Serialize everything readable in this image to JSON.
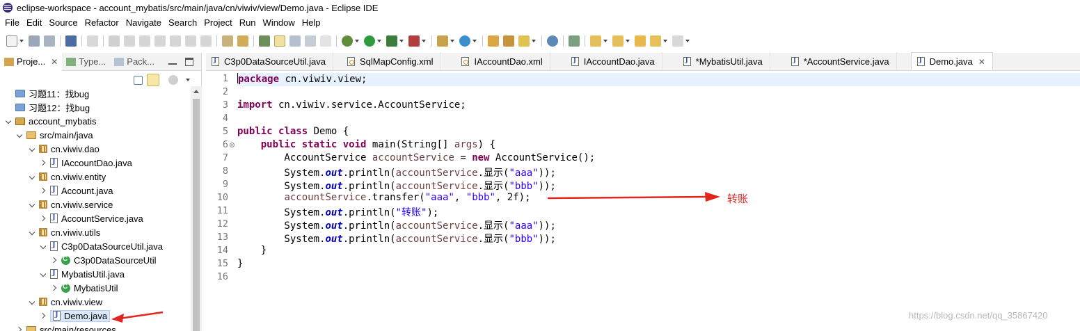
{
  "window": {
    "title": "eclipse-workspace - account_mybatis/src/main/java/cn/viwiv/view/Demo.java - Eclipse IDE"
  },
  "menu": [
    "File",
    "Edit",
    "Source",
    "Refactor",
    "Navigate",
    "Search",
    "Project",
    "Run",
    "Window",
    "Help"
  ],
  "left_tabs": [
    {
      "label": "Proje...",
      "close": "✕"
    },
    {
      "label": "Type..."
    },
    {
      "label": "Pack..."
    }
  ],
  "tree": [
    {
      "label": "习题11：找bug"
    },
    {
      "label": "习题12：找bug"
    },
    {
      "label": "account_mybatis"
    },
    {
      "label": "src/main/java"
    },
    {
      "label": "cn.viwiv.dao"
    },
    {
      "label": "IAccountDao.java"
    },
    {
      "label": "cn.viwiv.entity"
    },
    {
      "label": "Account.java"
    },
    {
      "label": "cn.viwiv.service"
    },
    {
      "label": "AccountService.java"
    },
    {
      "label": "cn.viwiv.utils"
    },
    {
      "label": "C3p0DataSourceUtil.java"
    },
    {
      "label": "C3p0DataSourceUtil"
    },
    {
      "label": "MybatisUtil.java"
    },
    {
      "label": "MybatisUtil"
    },
    {
      "label": "cn.viwiv.view"
    },
    {
      "label": "Demo.java"
    },
    {
      "label": "src/main/resources"
    }
  ],
  "editor_tabs": [
    {
      "label": "C3p0DataSourceUtil.java"
    },
    {
      "label": "SqlMapConfig.xml"
    },
    {
      "label": "IAccountDao.xml"
    },
    {
      "label": "IAccountDao.java"
    },
    {
      "label": "*MybatisUtil.java"
    },
    {
      "label": "*AccountService.java"
    },
    {
      "label": "Demo.java",
      "close": "✕"
    }
  ],
  "line_numbers": [
    "1",
    "2",
    "3",
    "4",
    "5",
    "6",
    "7",
    "8",
    "9",
    "10",
    "11",
    "12",
    "13",
    "14",
    "15",
    "16"
  ],
  "code": {
    "l1_kw": "package",
    "l1_rest": " cn.viwiv.view;",
    "l3_kw": "import",
    "l3_rest": " cn.viwiv.service.AccountService;",
    "l5_kw1": "public",
    "l5_kw2": "class",
    "l5_rest": " Demo {",
    "l6_indent": "    ",
    "l6_kw1": "public",
    "l6_kw2": "static",
    "l6_kw3": "void",
    "l6_a": " main(String[] ",
    "l6_var": "args",
    "l6_b": ") {",
    "l7_a": "        AccountService ",
    "l7_var": "accountService",
    "l7_b": " = ",
    "l7_kw": "new",
    "l7_c": " AccountService();",
    "l8_a": "        System.",
    "l8_out": "out",
    "l8_b": ".println(",
    "l8_var": "accountService",
    "l8_c": ".显示(",
    "l8_str": "\"aaa\"",
    "l8_d": "));",
    "l9_a": "        System.",
    "l9_out": "out",
    "l9_b": ".println(",
    "l9_var": "accountService",
    "l9_c": ".显示(",
    "l9_str": "\"bbb\"",
    "l9_d": "));",
    "l10_indent": "        ",
    "l10_var": "accountService",
    "l10_a": ".transfer(",
    "l10_s1": "\"aaa\"",
    "l10_b": ", ",
    "l10_s2": "\"bbb\"",
    "l10_c": ", 2f);",
    "l11_a": "        System.",
    "l11_out": "out",
    "l11_b": ".println(",
    "l11_str": "\"转账\"",
    "l11_c": ");",
    "l12_a": "        System.",
    "l12_out": "out",
    "l12_b": ".println(",
    "l12_var": "accountService",
    "l12_c": ".显示(",
    "l12_str": "\"aaa\"",
    "l12_d": "));",
    "l13_a": "        System.",
    "l13_out": "out",
    "l13_b": ".println(",
    "l13_var": "accountService",
    "l13_c": ".显示(",
    "l13_str": "\"bbb\"",
    "l13_d": "));",
    "l14": "    }",
    "l15": "}"
  },
  "annotation": {
    "text": "转账",
    "color": "#e0261f"
  },
  "watermark": "https://blog.csdn.net/qq_35867420",
  "colors": {
    "keyword": "#7f0055",
    "string": "#2a00ff",
    "field": "#0000c0",
    "local_var": "#6a3e3e",
    "line_highlight": "#e8f2fe",
    "selection": "#d9e8fb"
  },
  "icons": [
    "new-icon",
    "save-icon",
    "save-all-icon",
    "terminal-icon",
    "debug-icon",
    "run-icon",
    "coverage-icon",
    "external-tools-icon",
    "new-java-class-icon",
    "open-type-icon",
    "search-icon",
    "back-icon",
    "forward-icon"
  ]
}
